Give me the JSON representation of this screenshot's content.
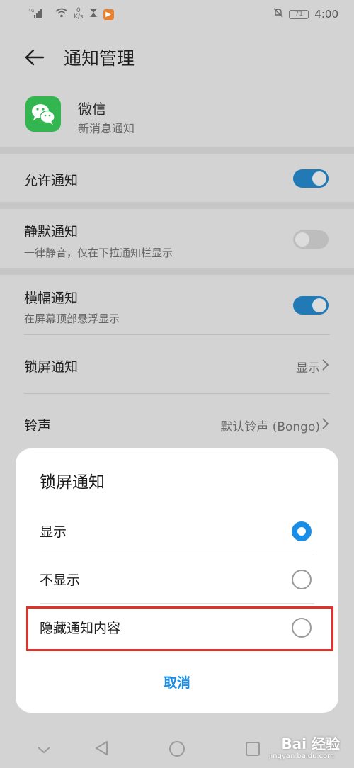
{
  "status_bar": {
    "network_speed_top": "0",
    "network_speed_unit": "K/s",
    "battery": "71",
    "time": "4:00",
    "signal_label": "4G"
  },
  "header": {
    "title": "通知管理"
  },
  "app": {
    "name": "微信",
    "subtitle": "新消息通知"
  },
  "settings": {
    "allow": {
      "label": "允许通知",
      "enabled": true
    },
    "silent": {
      "label": "静默通知",
      "sub": "一律静音，仅在下拉通知栏显示",
      "enabled": false
    },
    "banner": {
      "label": "横幅通知",
      "sub": "在屏幕顶部悬浮显示",
      "enabled": true
    },
    "lockscreen": {
      "label": "锁屏通知",
      "value": "显示"
    },
    "ringtone": {
      "label": "铃声",
      "value": "默认铃声 (Bongo)"
    }
  },
  "dialog": {
    "title": "锁屏通知",
    "options": [
      {
        "label": "显示",
        "selected": true
      },
      {
        "label": "不显示",
        "selected": false
      },
      {
        "label": "隐藏通知内容",
        "selected": false
      }
    ],
    "cancel": "取消"
  },
  "watermark": {
    "main": "Bai 经验",
    "sub": "jingyan.baidu.com"
  },
  "colors": {
    "accent": "#1a8ee6",
    "toggle_on": "#2179b5",
    "highlight": "#e2312b",
    "wechat_green": "#33b650"
  }
}
